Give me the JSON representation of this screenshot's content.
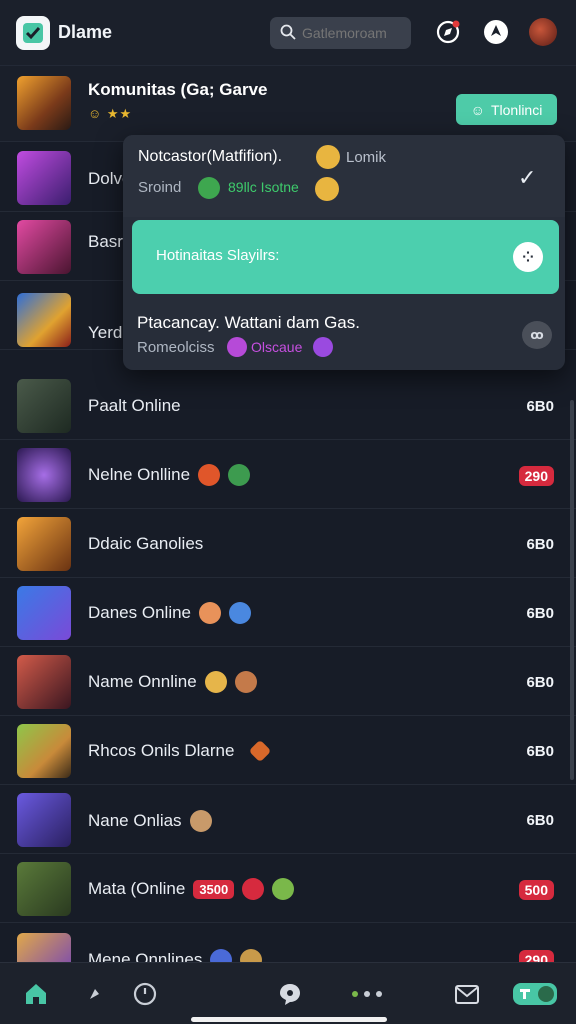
{
  "app": {
    "title": "Dlame",
    "search_placeholder": "Gatlemoroam"
  },
  "header": {
    "title": "Komunitas (Ga; Garve",
    "stars": "☺ ★★",
    "button_label": "Tlonlinci"
  },
  "dropdown": {
    "item1_title": "Notcastor(Matfifion).",
    "item1_extra": "Lomik",
    "item1_sub": "Sroind",
    "item1_sub_green": "89llc Isotne",
    "active_label": "Hotinaitas Slayilrs:",
    "item3_title": "Ptacancay. Wattani dam Gas.",
    "item3_sub": "Romeolciss",
    "item3_sub_purple": "Olscaue"
  },
  "partial_rows": [
    "Dolve",
    "Basr",
    "Yerd"
  ],
  "rows": [
    {
      "title": "Paalt Online",
      "value": "6B0"
    },
    {
      "title": "Nelne Onlline",
      "value": "290",
      "value_red": true
    },
    {
      "title": "Ddaic Ganolies",
      "value": "6B0"
    },
    {
      "title": "Danes Online",
      "value": "6B0"
    },
    {
      "title": "Name Onnline",
      "value": "6B0"
    },
    {
      "title": "Rhcos Onils Dlarne",
      "value": "6B0"
    },
    {
      "title": "Nane Onlias",
      "value": "6B0"
    },
    {
      "title": "Mata (Online",
      "chip": "3500",
      "value": "500",
      "value_red": true
    },
    {
      "title": "Mene Onnlines",
      "value": "290",
      "value_red": true
    }
  ],
  "colors": {
    "accent": "#4ecba8",
    "background": "#171c27",
    "danger": "#d62a3e"
  },
  "icons": [
    "check-logo-icon",
    "search-icon",
    "compass-icon",
    "location-icon",
    "avatar",
    "home-icon",
    "clock-icon",
    "chat-icon",
    "mail-icon",
    "toggle-icon"
  ]
}
